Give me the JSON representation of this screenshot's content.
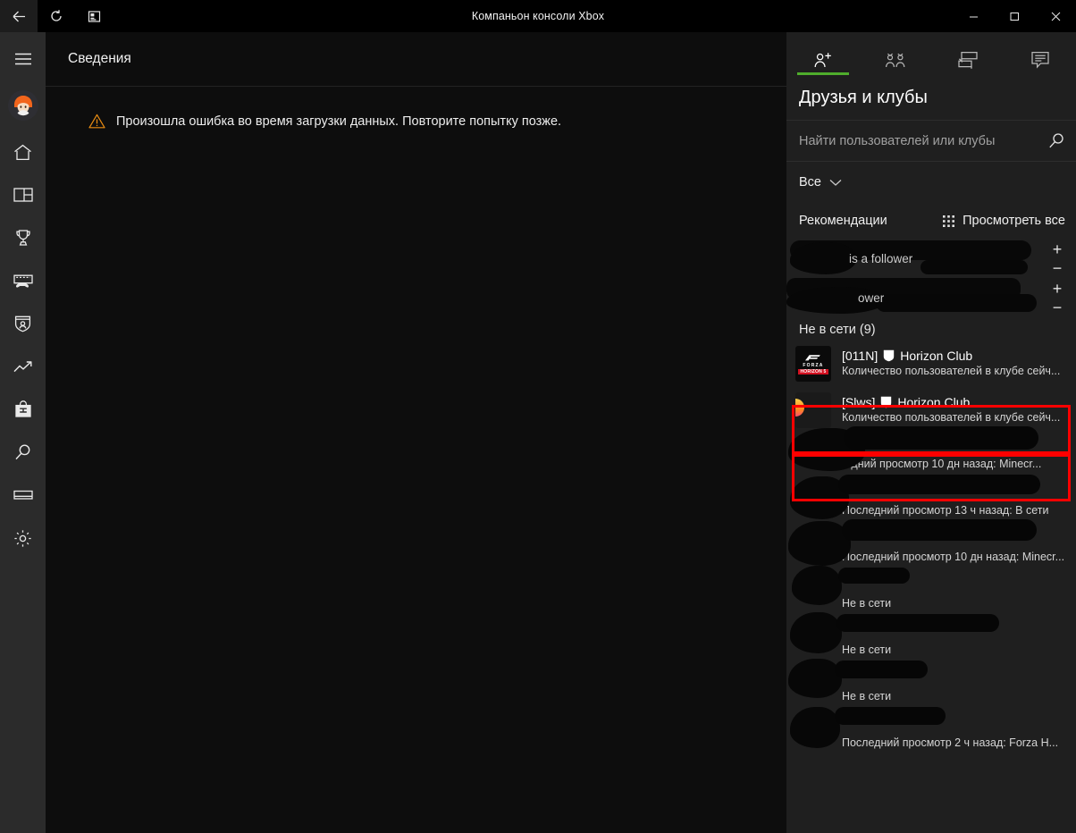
{
  "window": {
    "title": "Компаньон консоли Xbox",
    "back_icon": "back-arrow-icon",
    "refresh_icon": "refresh-icon",
    "screenshot_icon": "screenshot-icon",
    "minimize_label": "—",
    "maximize_label": "☐",
    "close_label": "✕"
  },
  "sidebar": {
    "menu_icon": "hamburger-menu-icon",
    "avatar_name": "user-avatar",
    "items": [
      {
        "icon": "home-icon",
        "name": "sidebar-item-home"
      },
      {
        "icon": "layout-icon",
        "name": "sidebar-item-feed"
      },
      {
        "icon": "trophy-icon",
        "name": "sidebar-item-achievements"
      },
      {
        "icon": "gameclips-icon",
        "name": "sidebar-item-captures"
      },
      {
        "icon": "club-shield-icon",
        "name": "sidebar-item-clubs"
      },
      {
        "icon": "trending-icon",
        "name": "sidebar-item-trending"
      },
      {
        "icon": "store-bag-icon",
        "name": "sidebar-item-store"
      },
      {
        "icon": "search-icon",
        "name": "sidebar-item-search"
      },
      {
        "icon": "console-icon",
        "name": "sidebar-item-console"
      },
      {
        "icon": "gear-icon",
        "name": "sidebar-item-settings"
      }
    ]
  },
  "main": {
    "title": "Сведения",
    "warning_icon": "warning-triangle-icon",
    "error_message": "Произошла ошибка во время загрузки данных. Повторите попытку позже."
  },
  "right_panel": {
    "accent_color": "#4fad2c",
    "tabs": [
      {
        "icon": "friends-person-add-icon",
        "name": "tab-friends",
        "active": true
      },
      {
        "icon": "party-group-icon",
        "name": "tab-party",
        "active": false
      },
      {
        "icon": "chat-split-icon",
        "name": "tab-chats",
        "active": false
      },
      {
        "icon": "message-bubble-icon",
        "name": "tab-messages",
        "active": false
      }
    ],
    "title": "Друзья и клубы",
    "search": {
      "placeholder": "Найти пользователей или клубы",
      "value": "",
      "icon": "search-icon"
    },
    "filter": {
      "label": "Все",
      "chevron": "chevron-down-icon"
    },
    "section": {
      "title": "Рекомендации",
      "view_all_label": "Просмотреть все",
      "view_all_icon": "grid-dots-icon"
    },
    "recommendations": [
      {
        "name": "is a follower",
        "add_label": "+",
        "remove_label": "−",
        "redacted": true
      },
      {
        "name": "ower",
        "add_label": "+",
        "remove_label": "−",
        "redacted": true
      }
    ],
    "offline_group_label": "Не в сети (9)",
    "entries": [
      {
        "tag": "[011N]",
        "name": "Horizon Club",
        "club_icon": "club-shield-icon",
        "status": "Количество пользователей в клубе сейч...",
        "thumb": "forza-horizon-5",
        "highlighted": true,
        "redacted": false
      },
      {
        "tag": "[Slws]",
        "name": "Horizon Club",
        "club_icon": "club-shield-icon",
        "status": "Количество пользователей в клубе сейч...",
        "thumb": "synthwave-car",
        "highlighted": true,
        "redacted": false
      },
      {
        "tag": "",
        "name": "",
        "status": "...дний просмотр 10 дн назад: Minecr...",
        "thumb": "redacted",
        "highlighted": false,
        "redacted": true
      },
      {
        "tag": "",
        "name": "",
        "status": "Последний просмотр 13 ч назад: В сети",
        "thumb": "redacted",
        "highlighted": false,
        "redacted": true
      },
      {
        "tag": "",
        "name": "",
        "status": "Последний просмотр 10 дн назад: Minecr...",
        "thumb": "redacted",
        "highlighted": false,
        "redacted": true
      },
      {
        "tag": "",
        "name": "",
        "status": "Не в сети",
        "thumb": "redacted",
        "highlighted": false,
        "redacted": true
      },
      {
        "tag": "",
        "name": "",
        "status": "Не в сети",
        "thumb": "redacted",
        "highlighted": false,
        "redacted": true
      },
      {
        "tag": "",
        "name": "",
        "status": "Не в сети",
        "thumb": "redacted",
        "highlighted": false,
        "redacted": true
      },
      {
        "tag": "",
        "name": "",
        "status": "Последний просмотр 2 ч назад: Forza H...",
        "thumb": "redacted",
        "highlighted": false,
        "redacted": true
      }
    ]
  }
}
